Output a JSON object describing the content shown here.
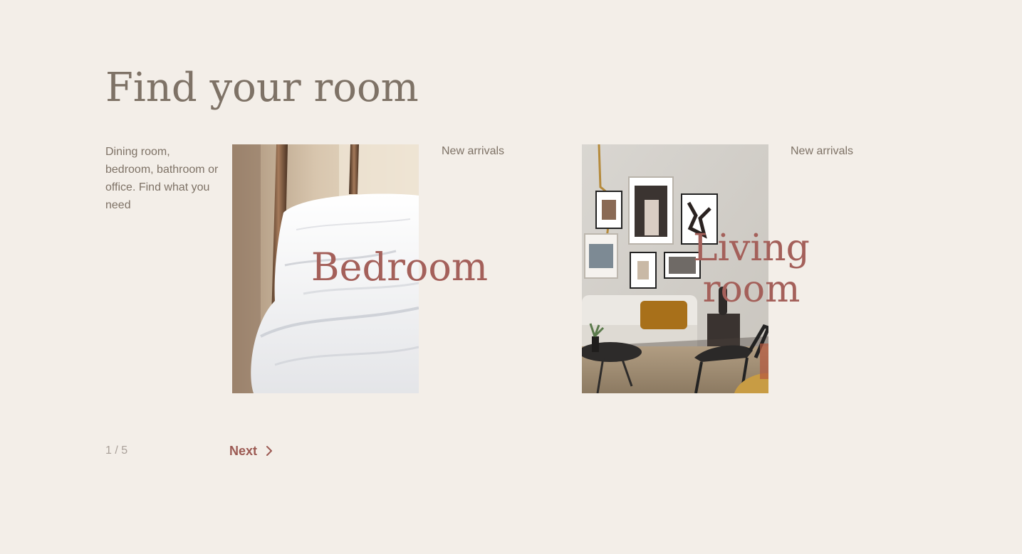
{
  "header": {
    "title": "Find your room"
  },
  "intro": {
    "text": "Dining room, bedroom, bathroom or office. Find what you need"
  },
  "cards": [
    {
      "label": "Bedroom",
      "tag": "New arrivals",
      "image": "bedroom-photo"
    },
    {
      "label": "Living room",
      "tag": "New arrivals",
      "image": "living-room-photo"
    }
  ],
  "pagination": {
    "indicator": "1 / 5",
    "next_label": "Next",
    "next_icon": "chevron-right-icon"
  },
  "colors": {
    "background": "#f3eee8",
    "heading": "#7e7266",
    "accent": "#a4605a",
    "muted": "#a9a099"
  }
}
